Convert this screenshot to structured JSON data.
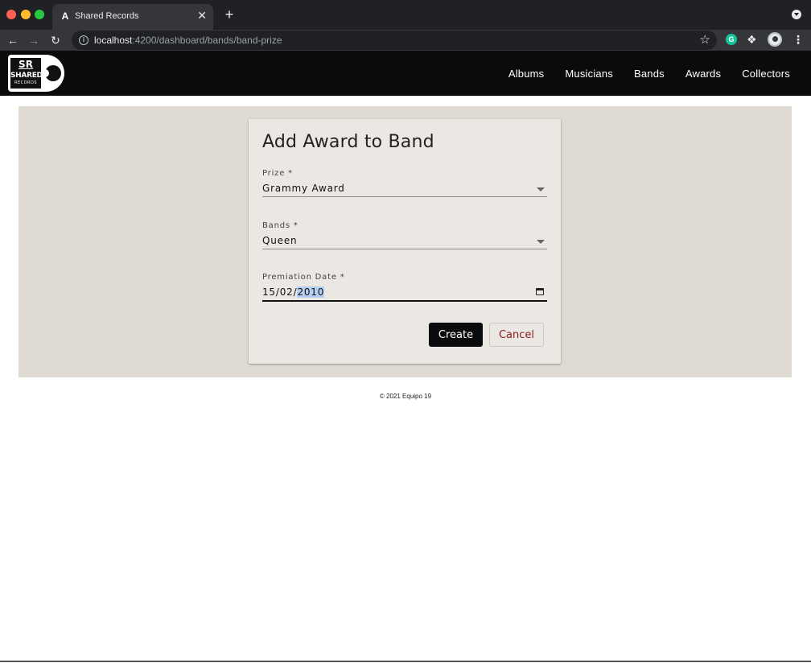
{
  "browser": {
    "tab_favicon": "A",
    "tab_title": "Shared Records",
    "tab_close": "✕",
    "new_tab": "+",
    "url_host": "localhost",
    "url_path": ":4200/dashboard/bands/band-prize",
    "extension_badge": "G"
  },
  "logo": {
    "line1": "SR",
    "line2": "SHARED",
    "line3": "RECORDS"
  },
  "nav": {
    "items": [
      {
        "label": "Albums"
      },
      {
        "label": "Musicians"
      },
      {
        "label": "Bands"
      },
      {
        "label": "Awards"
      },
      {
        "label": "Collectors"
      }
    ]
  },
  "form": {
    "title": "Add Award to Band",
    "prize": {
      "label": "Prize *",
      "value": "Grammy Award"
    },
    "bands": {
      "label": "Bands *",
      "value": "Queen"
    },
    "date": {
      "label": "Premiation Date *",
      "value_prefix": "15/02/",
      "value_selected": "2010"
    },
    "create_label": "Create",
    "cancel_label": "Cancel"
  },
  "footer": {
    "text": "© 2021 Equipo 19"
  },
  "colors": {
    "navbar": "#0a0b0d",
    "content_bg": "#dfdbd3",
    "card_bg": "#ebe8e3",
    "cancel_text": "#8b1a1a",
    "selection": "#b4cff0"
  }
}
